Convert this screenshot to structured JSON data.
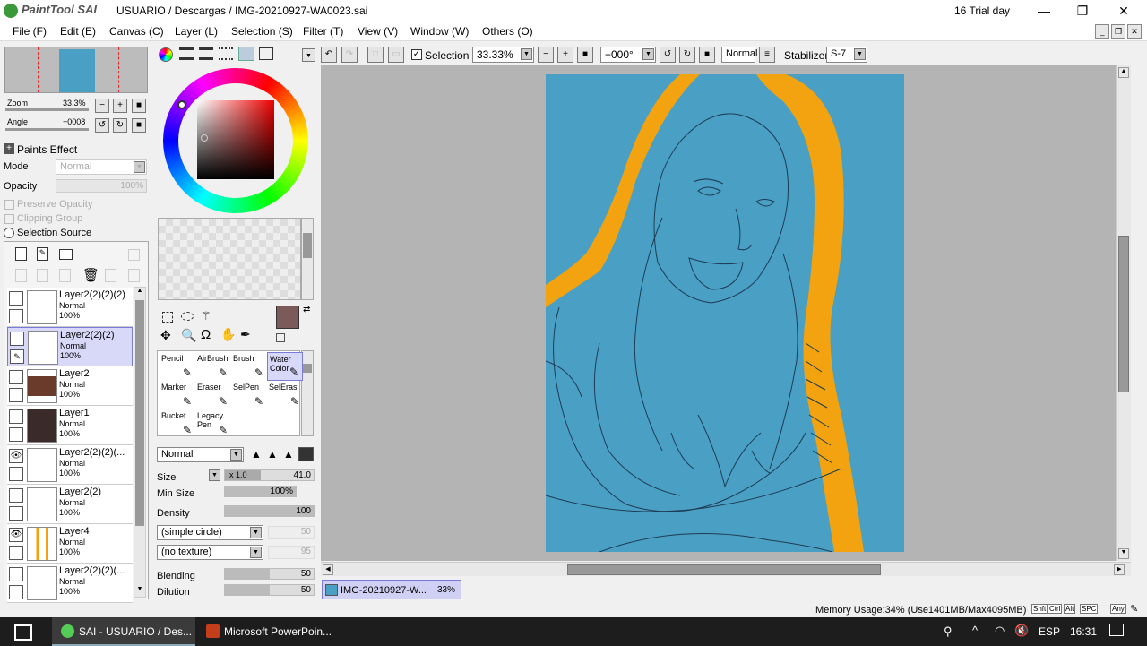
{
  "titlebar": {
    "logo_text": "PaintTool SAI",
    "path": "USUARIO / Descargas / IMG-20210927-WA0023.sai",
    "trial": "16 Trial day"
  },
  "menu": [
    "File (F)",
    "Edit (E)",
    "Canvas (C)",
    "Layer (L)",
    "Selection (S)",
    "Filter (T)",
    "View (V)",
    "Window (W)",
    "Others (O)"
  ],
  "navigator": {
    "zoom_label": "Zoom",
    "zoom_value": "33.3%",
    "angle_label": "Angle",
    "angle_value": "+0008"
  },
  "paints_effect": {
    "title": "Paints Effect",
    "mode_label": "Mode",
    "mode_value": "Normal",
    "opacity_label": "Opacity",
    "opacity_value": "100%",
    "preserve_opacity": "Preserve Opacity",
    "clipping_group": "Clipping Group",
    "selection_source": "Selection Source"
  },
  "layers": [
    {
      "name": "Layer2(2)(2)(2)",
      "mode": "Normal",
      "opacity": "100%",
      "visible": false,
      "selected": false
    },
    {
      "name": "Layer2(2)(2)",
      "mode": "Normal",
      "opacity": "100%",
      "visible": false,
      "selected": true
    },
    {
      "name": "Layer2",
      "mode": "Normal",
      "opacity": "100%",
      "visible": false,
      "selected": false
    },
    {
      "name": "Layer1",
      "mode": "Normal",
      "opacity": "100%",
      "visible": false,
      "selected": false
    },
    {
      "name": "Layer2(2)(2)(...",
      "mode": "Normal",
      "opacity": "100%",
      "visible": true,
      "selected": false
    },
    {
      "name": "Layer2(2)",
      "mode": "Normal",
      "opacity": "100%",
      "visible": false,
      "selected": false
    },
    {
      "name": "Layer4",
      "mode": "Normal",
      "opacity": "100%",
      "visible": true,
      "selected": false
    },
    {
      "name": "Layer2(2)(2)(...",
      "mode": "Normal",
      "opacity": "100%",
      "visible": false,
      "selected": false
    }
  ],
  "colors": {
    "primary": "#7d5a5a",
    "canvas_bg": "#4a9fc4",
    "hair": "#f2a30f",
    "lineart": "#1e3c55"
  },
  "tools": [
    {
      "label1": "Pencil",
      "label2": ""
    },
    {
      "label1": "AirBrush",
      "label2": ""
    },
    {
      "label1": "Brush",
      "label2": ""
    },
    {
      "label1": "Water",
      "label2": "Color"
    },
    {
      "label1": "Marker",
      "label2": ""
    },
    {
      "label1": "Eraser",
      "label2": ""
    },
    {
      "label1": "SelPen",
      "label2": ""
    },
    {
      "label1": "SelEras",
      "label2": ""
    },
    {
      "label1": "Bucket",
      "label2": ""
    },
    {
      "label1": "Legacy",
      "label2": "Pen"
    }
  ],
  "brush": {
    "mode": "Normal",
    "size_label": "Size",
    "size_mult": "x 1.0",
    "size_value": "41.0",
    "minsize_label": "Min Size",
    "minsize_value": "100%",
    "density_label": "Density",
    "density_value": "100",
    "shape": "(simple circle)",
    "shape_value": "50",
    "texture": "(no texture)",
    "texture_value": "95",
    "blending_label": "Blending",
    "blending_value": "50",
    "dilution_label": "Dilution",
    "dilution_value": "50"
  },
  "toolbar": {
    "selection_label": "Selection",
    "zoom": "33.33%",
    "angle": "+000°",
    "blend": "Normal",
    "stabilizer_label": "Stabilizer",
    "stabilizer_value": "S-7"
  },
  "doc_tab": {
    "name": "IMG-20210927-W...",
    "zoom": "33%"
  },
  "status": {
    "memory": "Memory Usage:34% (Use1401MB/Max4095MB)",
    "keys": [
      "Shft",
      "Ctrl",
      "Alt",
      "SPC",
      "Any"
    ]
  },
  "taskbar": {
    "app1": "SAI - USUARIO / Des...",
    "app2": "Microsoft PowerPoin...",
    "lang": "ESP",
    "time": "16:31"
  }
}
